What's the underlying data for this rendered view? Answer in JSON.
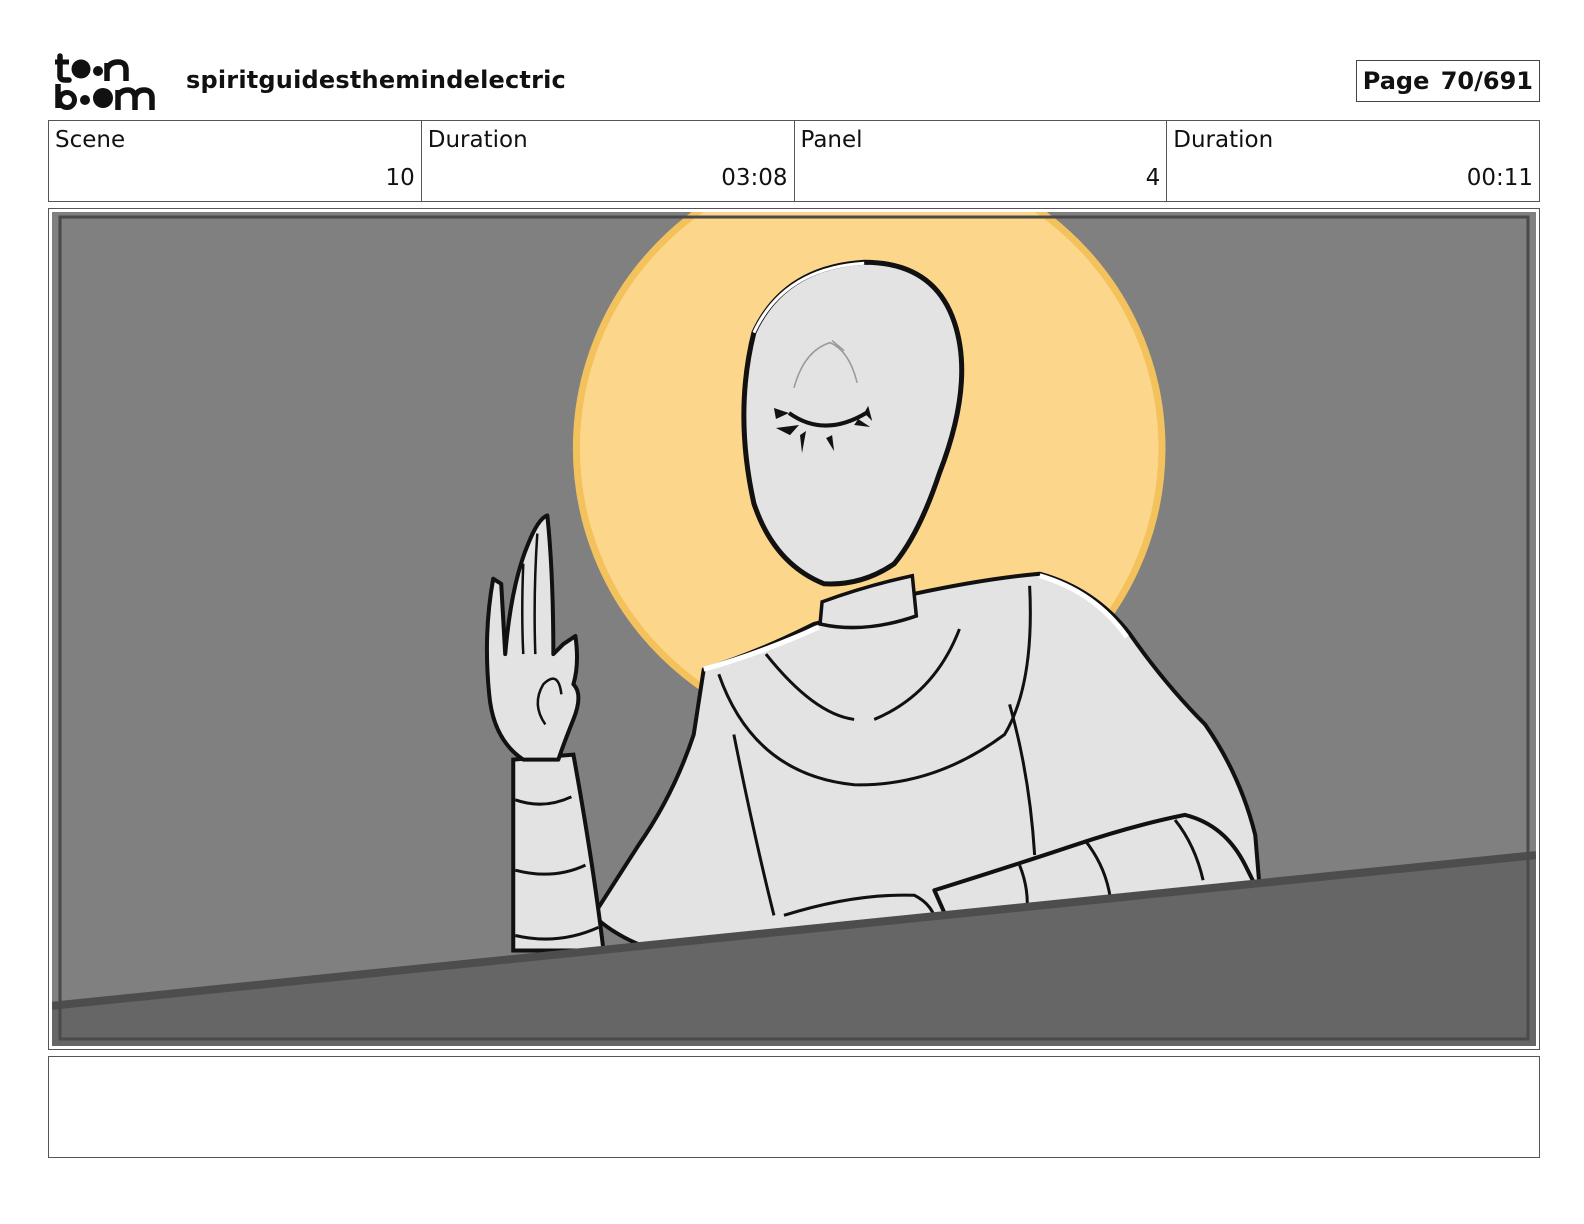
{
  "header": {
    "logo_text_top": "toon",
    "logo_text_bottom": "boom",
    "project_title": "spiritguidesthemindelectric",
    "page_label": "Page 70/691"
  },
  "info": {
    "scene_label": "Scene",
    "scene_value": "10",
    "scene_duration_label": "Duration",
    "scene_duration_value": "03:08",
    "panel_label": "Panel",
    "panel_value": "4",
    "panel_duration_label": "Duration",
    "panel_duration_value": "00:11"
  },
  "colors": {
    "background": "#808080",
    "halo": "#fcd68a",
    "halo_edge": "#f4c25c",
    "figure": "#e3e3e3",
    "foreground": "#666666"
  },
  "notes": {
    "text": ""
  }
}
